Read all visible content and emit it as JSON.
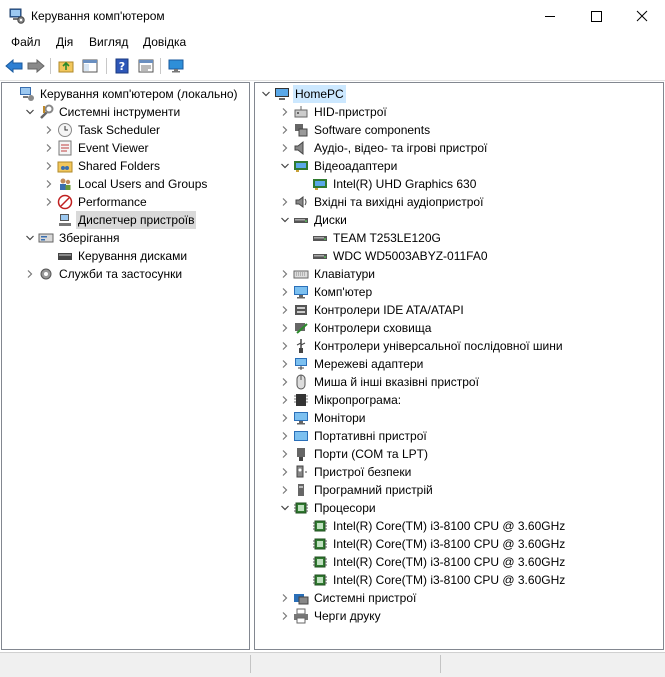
{
  "window": {
    "title": "Керування комп'ютером"
  },
  "menu": [
    "Файл",
    "Дія",
    "Вигляд",
    "Довідка"
  ],
  "toolbar": [
    "back",
    "forward",
    "up-folder",
    "show-hide-tree",
    "help",
    "properties",
    "monitor"
  ],
  "left_tree": [
    {
      "label": "Керування комп'ютером (локально)",
      "level": 0,
      "arrow": "none",
      "icon": "computer-management-icon"
    },
    {
      "label": "Системні інструменти",
      "level": 1,
      "arrow": "expanded",
      "icon": "tools-icon"
    },
    {
      "label": "Task Scheduler",
      "level": 2,
      "arrow": "collapsed",
      "icon": "clock-icon"
    },
    {
      "label": "Event Viewer",
      "level": 2,
      "arrow": "collapsed",
      "icon": "event-viewer-icon"
    },
    {
      "label": "Shared Folders",
      "level": 2,
      "arrow": "collapsed",
      "icon": "shared-folder-icon"
    },
    {
      "label": "Local Users and Groups",
      "level": 2,
      "arrow": "collapsed",
      "icon": "users-icon"
    },
    {
      "label": "Performance",
      "level": 2,
      "arrow": "collapsed",
      "icon": "performance-icon"
    },
    {
      "label": "Диспетчер пристроїв",
      "level": 2,
      "arrow": "none",
      "icon": "device-manager-icon",
      "selected": true
    },
    {
      "label": "Зберігання",
      "level": 1,
      "arrow": "expanded",
      "icon": "storage-icon"
    },
    {
      "label": "Керування дисками",
      "level": 2,
      "arrow": "none",
      "icon": "disk-management-icon"
    },
    {
      "label": "Служби та застосунки",
      "level": 1,
      "arrow": "collapsed",
      "icon": "services-icon"
    }
  ],
  "right_tree": [
    {
      "label": "HomePC",
      "level": 0,
      "arrow": "expanded",
      "icon": "computer-icon",
      "root": true
    },
    {
      "label": "HID-пристрої",
      "level": 1,
      "arrow": "collapsed",
      "icon": "hid-icon"
    },
    {
      "label": "Software components",
      "level": 1,
      "arrow": "collapsed",
      "icon": "software-components-icon"
    },
    {
      "label": "Аудіо-, відео- та ігрові пристрої",
      "level": 1,
      "arrow": "collapsed",
      "icon": "speaker-icon"
    },
    {
      "label": "Відеоадаптери",
      "level": 1,
      "arrow": "expanded",
      "icon": "display-adapter-icon"
    },
    {
      "label": "Intel(R) UHD Graphics 630",
      "level": 2,
      "arrow": "none",
      "icon": "display-adapter-icon"
    },
    {
      "label": "Вхідні та вихідні аудіопристрої",
      "level": 1,
      "arrow": "collapsed",
      "icon": "audio-io-icon"
    },
    {
      "label": "Диски",
      "level": 1,
      "arrow": "expanded",
      "icon": "disk-drive-icon"
    },
    {
      "label": "TEAM T253LE120G",
      "level": 2,
      "arrow": "none",
      "icon": "disk-drive-icon"
    },
    {
      "label": "WDC WD5003ABYZ-011FA0",
      "level": 2,
      "arrow": "none",
      "icon": "disk-drive-icon"
    },
    {
      "label": "Клавіатури",
      "level": 1,
      "arrow": "collapsed",
      "icon": "keyboard-icon"
    },
    {
      "label": "Комп'ютер",
      "level": 1,
      "arrow": "collapsed",
      "icon": "monitor-icon"
    },
    {
      "label": "Контролери IDE ATA/ATAPI",
      "level": 1,
      "arrow": "collapsed",
      "icon": "ide-controller-icon"
    },
    {
      "label": "Контролери сховища",
      "level": 1,
      "arrow": "collapsed",
      "icon": "storage-controller-icon"
    },
    {
      "label": "Контролери універсальної послідовної шини",
      "level": 1,
      "arrow": "collapsed",
      "icon": "usb-icon"
    },
    {
      "label": "Мережеві адаптери",
      "level": 1,
      "arrow": "collapsed",
      "icon": "network-adapter-icon"
    },
    {
      "label": "Миша й інші вказівні пристрої",
      "level": 1,
      "arrow": "collapsed",
      "icon": "mouse-icon"
    },
    {
      "label": "Мікропрограма:",
      "level": 1,
      "arrow": "collapsed",
      "icon": "firmware-icon"
    },
    {
      "label": "Монітори",
      "level": 1,
      "arrow": "collapsed",
      "icon": "monitor-icon"
    },
    {
      "label": "Портативні пристрої",
      "level": 1,
      "arrow": "collapsed",
      "icon": "portable-device-icon"
    },
    {
      "label": "Порти (COM та LPT)",
      "level": 1,
      "arrow": "collapsed",
      "icon": "port-icon"
    },
    {
      "label": "Пристрої безпеки",
      "level": 1,
      "arrow": "collapsed",
      "icon": "security-device-icon"
    },
    {
      "label": "Програмний пристрій",
      "level": 1,
      "arrow": "collapsed",
      "icon": "software-device-icon"
    },
    {
      "label": "Процесори",
      "level": 1,
      "arrow": "expanded",
      "icon": "processor-icon"
    },
    {
      "label": "Intel(R) Core(TM) i3-8100 CPU @ 3.60GHz",
      "level": 2,
      "arrow": "none",
      "icon": "processor-icon"
    },
    {
      "label": "Intel(R) Core(TM) i3-8100 CPU @ 3.60GHz",
      "level": 2,
      "arrow": "none",
      "icon": "processor-icon"
    },
    {
      "label": "Intel(R) Core(TM) i3-8100 CPU @ 3.60GHz",
      "level": 2,
      "arrow": "none",
      "icon": "processor-icon"
    },
    {
      "label": "Intel(R) Core(TM) i3-8100 CPU @ 3.60GHz",
      "level": 2,
      "arrow": "none",
      "icon": "processor-icon"
    },
    {
      "label": "Системні пристрої",
      "level": 1,
      "arrow": "collapsed",
      "icon": "system-devices-icon"
    },
    {
      "label": "Черги друку",
      "level": 1,
      "arrow": "collapsed",
      "icon": "printer-icon"
    }
  ]
}
